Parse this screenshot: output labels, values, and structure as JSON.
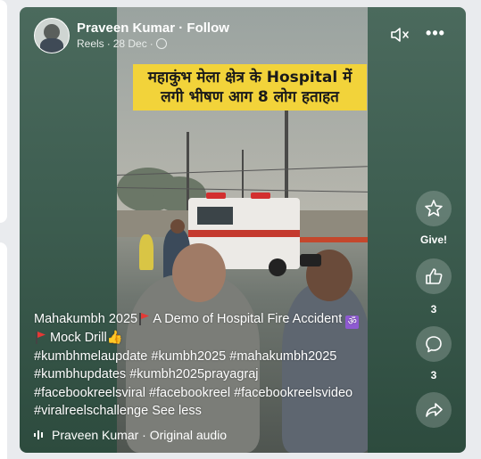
{
  "post": {
    "author": "Praveen Kumar",
    "follow": "Follow",
    "separator": "·",
    "type": "Reels",
    "date": "28 Dec",
    "privacy_icon": "globe-icon"
  },
  "video": {
    "overlay_line1": "महाकुंभ मेला क्षेत्र के Hospital में",
    "overlay_line2": "लगी भीषण आग 8 लोग हताहत"
  },
  "caption": {
    "line1_a": "Mahakumbh 2025",
    "line1_b": "A Demo of Hospital Fire Accident",
    "line2": "Mock Drill",
    "line2_emoji": "👍",
    "line3": "#kumbhmelaupdate #kumbh2025 #mahakumbh2025",
    "line4": "#kumbhupdates #kumbh2025prayagraj",
    "line5": "#facebookreelsviral #facebookreel #facebookreelsvideo",
    "line6": "#viralreelschallenge",
    "see_less": "See less",
    "om": "ॐ"
  },
  "actions": {
    "give_label": "Give!",
    "like_count": "3",
    "comment_count": "3"
  },
  "audio": {
    "text": "Praveen Kumar · Original audio"
  }
}
